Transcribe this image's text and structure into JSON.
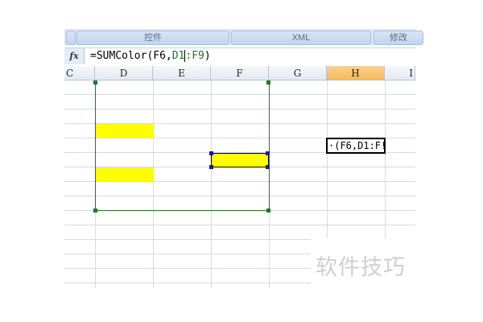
{
  "ribbon": {
    "groups": [
      "控件",
      "XML",
      "修改"
    ]
  },
  "formula_bar": {
    "fx_label": "fx",
    "prefix": "=SUMColor(F6,",
    "ref1": "D1",
    "ref2": ":F9",
    "suffix": ")"
  },
  "columns": [
    "C",
    "D",
    "E",
    "F",
    "G",
    "H",
    "I"
  ],
  "active_cell": {
    "column": "H",
    "edit_text": "·(F6,D1:F!"
  },
  "colors": {
    "highlight": "#ffff00",
    "range_border": "#1f7a1f",
    "selected_header": "#f6b757"
  },
  "watermark": "软件技巧"
}
